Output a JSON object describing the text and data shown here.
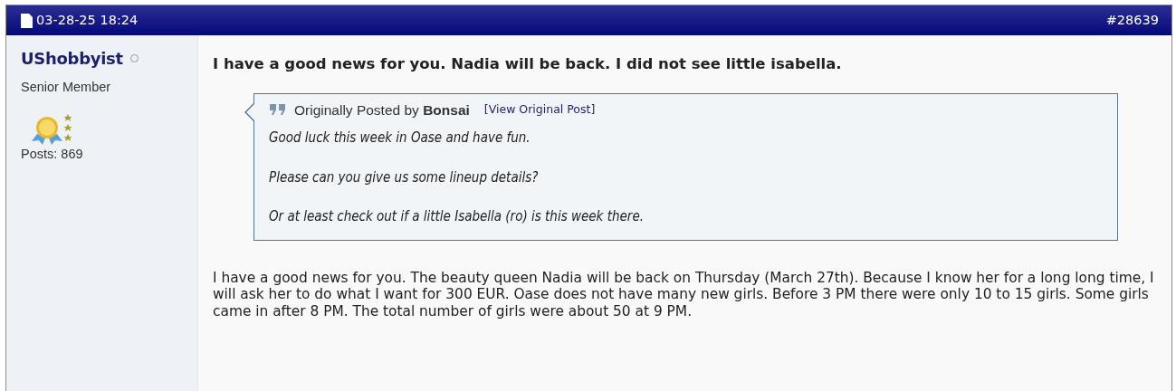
{
  "post_header": {
    "date": "03-28-25 18:24",
    "post_number": "#28639"
  },
  "author": {
    "username": "UShobbyist",
    "rank": "Senior Member",
    "posts": "Posts: 869"
  },
  "post": {
    "title": "I have a good news for you. Nadia will be back. I did not see little isabella.",
    "quote": {
      "prefix": "Originally Posted by",
      "author": "Bonsai",
      "link": "[View Original Post]",
      "lines": [
        "Good luck this week in Oase and have fun.",
        "Please can you give us some lineup details?",
        "Or at least check out if a little Isabella (ro) is this week there."
      ]
    },
    "body": "I have a good news for you. The beauty queen Nadia will be back on Thursday (March 27th). Because I know her for a long long time, I will ask her to do what I want for 300 EUR. Oase does not have many new girls. Before 3 PM there were only 10 to 15 girls. Some girls came in after 8 PM. The total number of girls were about 50 at 9 PM."
  }
}
